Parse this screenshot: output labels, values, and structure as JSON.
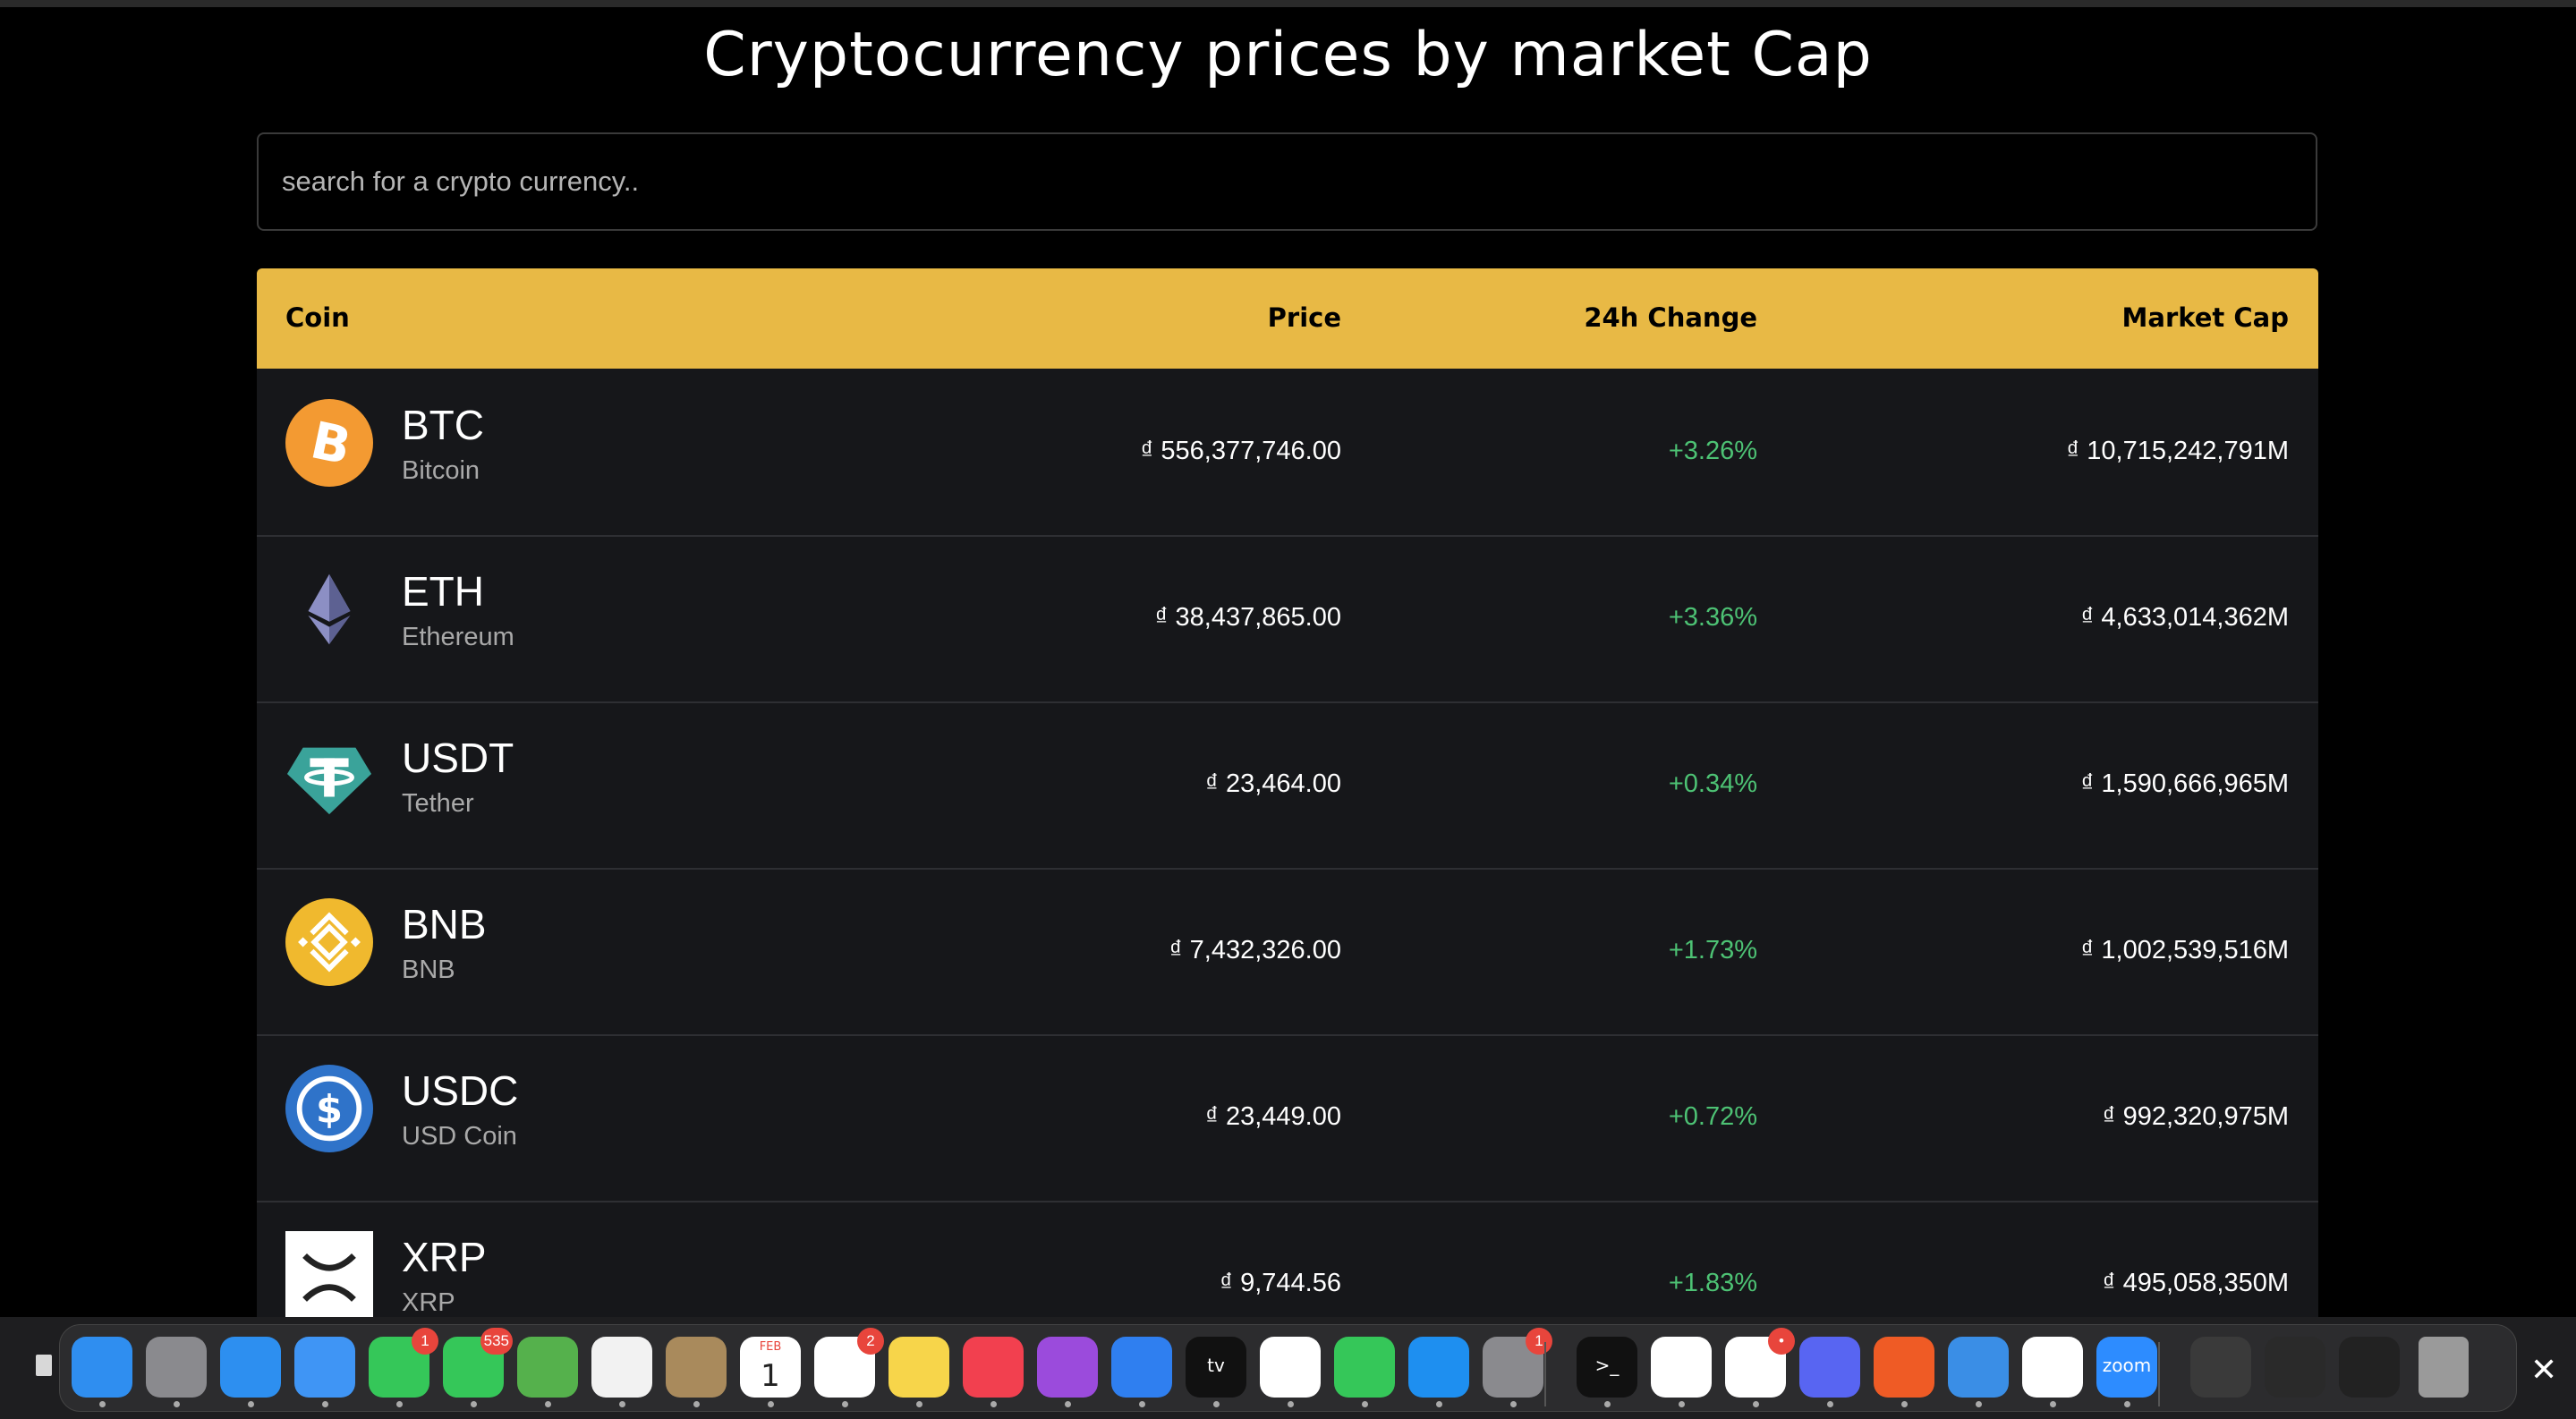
{
  "page": {
    "title": "Cryptocurrency prices by market Cap"
  },
  "search": {
    "placeholder": "search for a crypto currency..",
    "value": ""
  },
  "table": {
    "headers": {
      "coin": "Coin",
      "price": "Price",
      "change": "24h Change",
      "market_cap": "Market Cap"
    },
    "rows": [
      {
        "symbol": "BTC",
        "name": "Bitcoin",
        "price": "₫ 556,377,746.00",
        "change": "+3.26%",
        "market_cap": "₫ 10,715,242,791M",
        "icon": "bitcoin-icon"
      },
      {
        "symbol": "ETH",
        "name": "Ethereum",
        "price": "₫ 38,437,865.00",
        "change": "+3.36%",
        "market_cap": "₫ 4,633,014,362M",
        "icon": "ethereum-icon"
      },
      {
        "symbol": "USDT",
        "name": "Tether",
        "price": "₫ 23,464.00",
        "change": "+0.34%",
        "market_cap": "₫ 1,590,666,965M",
        "icon": "tether-icon"
      },
      {
        "symbol": "BNB",
        "name": "BNB",
        "price": "₫ 7,432,326.00",
        "change": "+1.73%",
        "market_cap": "₫ 1,002,539,516M",
        "icon": "bnb-icon"
      },
      {
        "symbol": "USDC",
        "name": "USD Coin",
        "price": "₫ 23,449.00",
        "change": "+0.72%",
        "market_cap": "₫ 992,320,975M",
        "icon": "usd-coin-icon"
      },
      {
        "symbol": "XRP",
        "name": "XRP",
        "price": "₫ 9,744.56",
        "change": "+1.83%",
        "market_cap": "₫ 495,058,350M",
        "icon": "xrp-icon"
      }
    ]
  },
  "colors": {
    "accent": "#e8b945",
    "positive": "#4dc274",
    "row_bg": "#16171a"
  },
  "dock": {
    "apps": [
      {
        "name": "finder",
        "color": "#2f8ef0"
      },
      {
        "name": "launchpad",
        "color": "#8a8a8e"
      },
      {
        "name": "safari",
        "color": "#2d8ff0"
      },
      {
        "name": "mail",
        "color": "#3f95f5"
      },
      {
        "name": "facetime",
        "color": "#35c759",
        "badge": "1"
      },
      {
        "name": "messages",
        "color": "#35c759",
        "badge": "535"
      },
      {
        "name": "maps",
        "color": "#55b14c"
      },
      {
        "name": "photos",
        "color": "#f2f2f2"
      },
      {
        "name": "contacts",
        "color": "#a98a5c"
      },
      {
        "name": "calendar",
        "color": "#ffffff",
        "label_month": "FEB",
        "label_day": "1"
      },
      {
        "name": "reminders",
        "color": "#ffffff",
        "badge": "2"
      },
      {
        "name": "notes",
        "color": "#f7d54a"
      },
      {
        "name": "music",
        "color": "#f2404f"
      },
      {
        "name": "podcasts",
        "color": "#9b4bdc"
      },
      {
        "name": "keynote",
        "color": "#2f7ff0"
      },
      {
        "name": "apple-tv",
        "color": "#111111",
        "label": "tv"
      },
      {
        "name": "news",
        "color": "#ffffff"
      },
      {
        "name": "numbers",
        "color": "#35c759"
      },
      {
        "name": "app-store",
        "color": "#1e8ff0"
      },
      {
        "name": "system-settings",
        "color": "#8a8a8e",
        "badge": "1"
      },
      {
        "name": "terminal",
        "color": "#111111",
        "label": ">_"
      },
      {
        "name": "chrome",
        "color": "#ffffff"
      },
      {
        "name": "slack",
        "color": "#ffffff",
        "badge": "•"
      },
      {
        "name": "discord",
        "color": "#5865f2"
      },
      {
        "name": "postman",
        "color": "#ef5b25"
      },
      {
        "name": "tableplus",
        "color": "#3a8ee6"
      },
      {
        "name": "vscode",
        "color": "#ffffff"
      },
      {
        "name": "zoom",
        "color": "#2d8cff",
        "label": "zoom"
      },
      {
        "name": "recent-window-1",
        "color": "#3a3a3a"
      },
      {
        "name": "recent-window-2",
        "color": "#2a2a2a"
      },
      {
        "name": "recent-window-3",
        "color": "#222222"
      },
      {
        "name": "trash",
        "color": "#9a9a9a"
      }
    ]
  }
}
